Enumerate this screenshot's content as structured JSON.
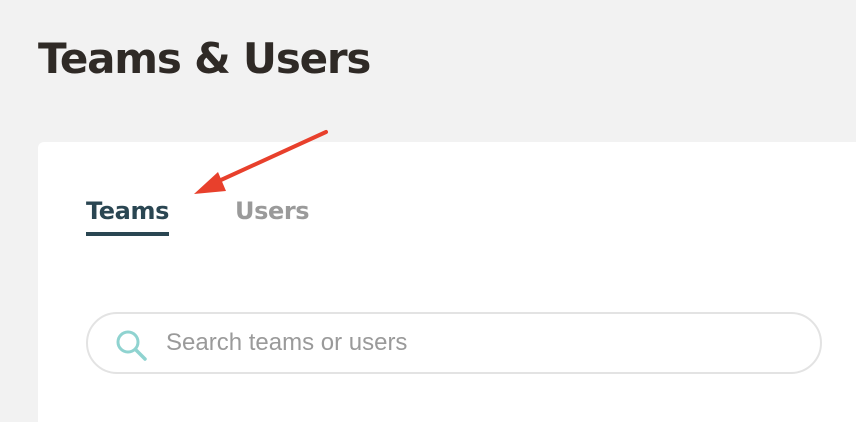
{
  "page": {
    "title": "Teams & Users"
  },
  "tabs": [
    {
      "label": "Teams",
      "active": true
    },
    {
      "label": "Users",
      "active": false
    }
  ],
  "search": {
    "placeholder": "Search teams or users",
    "value": "",
    "icon": "search-icon"
  },
  "colors": {
    "background": "#f2f2f2",
    "title_text": "#2f2a26",
    "active_tab": "#2a4652",
    "inactive_tab": "#9a9a9a",
    "search_icon": "#8fd3d0",
    "annotation_arrow": "#e8402c"
  }
}
